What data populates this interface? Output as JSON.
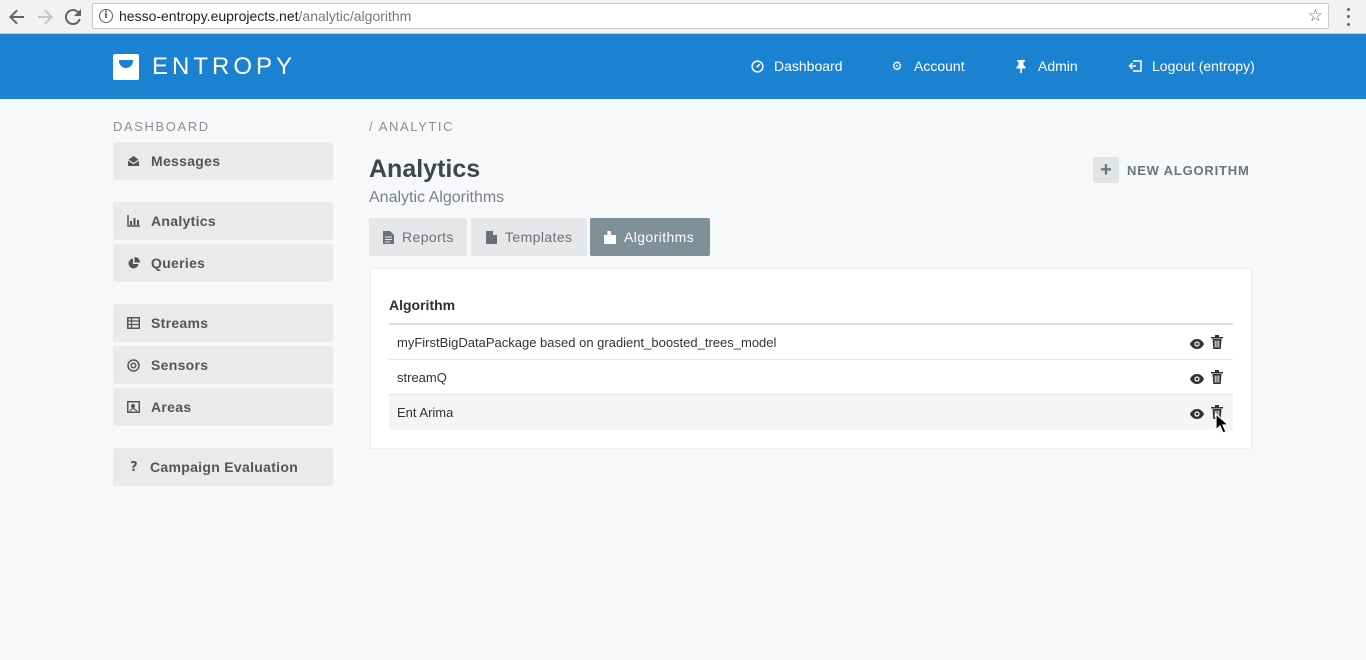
{
  "browser": {
    "url_host": "hesso-entropy.euprojects.net",
    "url_path": "/analytic/algorithm"
  },
  "header": {
    "logo_text": "ENTROPY",
    "nav": [
      {
        "label": "Dashboard",
        "icon": "dashboard-icon"
      },
      {
        "label": "Account",
        "icon": "gear-icon"
      },
      {
        "label": "Admin",
        "icon": "pin-icon"
      },
      {
        "label": "Logout (entropy)",
        "icon": "logout-icon"
      }
    ]
  },
  "sidebar": {
    "title": "DASHBOARD",
    "items": [
      {
        "label": "Messages",
        "icon": "envelope-icon"
      },
      {
        "label": "Analytics",
        "icon": "bar-chart-icon"
      },
      {
        "label": "Queries",
        "icon": "pie-chart-icon"
      },
      {
        "label": "Streams",
        "icon": "table-icon"
      },
      {
        "label": "Sensors",
        "icon": "target-icon"
      },
      {
        "label": "Areas",
        "icon": "map-icon"
      },
      {
        "label": "Campaign Evaluation",
        "icon": "question-icon"
      }
    ]
  },
  "main": {
    "breadcrumb": "/ ANALYTIC",
    "title": "Analytics",
    "subtitle": "Analytic Algorithms",
    "new_button": "NEW ALGORITHM",
    "tabs": [
      {
        "label": "Reports",
        "icon": "file-icon",
        "active": false
      },
      {
        "label": "Templates",
        "icon": "file-icon",
        "active": false
      },
      {
        "label": "Algorithms",
        "icon": "puzzle-icon",
        "active": true
      }
    ],
    "table": {
      "header": "Algorithm",
      "rows": [
        {
          "name": "myFirstBigDataPackage based on gradient_boosted_trees_model"
        },
        {
          "name": "streamQ"
        },
        {
          "name": "Ent Arima"
        }
      ]
    }
  },
  "colors": {
    "brand_blue": "#1a82d1",
    "active_tab": "#7e9098",
    "sidebar_item_bg": "#e9eaeb"
  }
}
